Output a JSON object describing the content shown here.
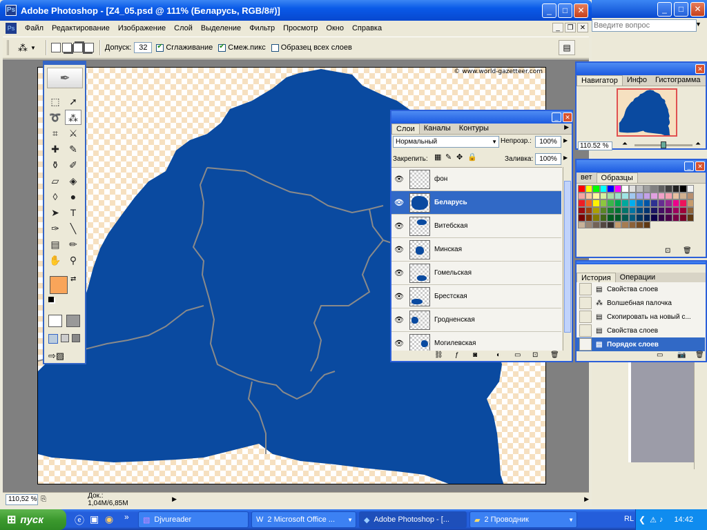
{
  "window": {
    "title": "Adobe Photoshop - [Z4_05.psd @ 111% (Беларусь, RGB/8#)]",
    "min_glyph": "_",
    "max_glyph": "□",
    "close_glyph": "✕"
  },
  "menu": [
    "Файл",
    "Редактирование",
    "Изображение",
    "Слой",
    "Выделение",
    "Фильтр",
    "Просмотр",
    "Окно",
    "Справка"
  ],
  "options": {
    "tolerance_label": "Допуск:",
    "tolerance_value": "32",
    "antialias_label": "Сглаживание",
    "contiguous_label": "Смеж.пикс",
    "sample_all_label": "Образец всех слоев"
  },
  "help": {
    "placeholder": "Введите вопрос"
  },
  "canvas": {
    "copyright": "© www.world-gazetteer.com",
    "map_color": "#0a4aa0",
    "border_color": "#8a8a8a",
    "transparency_color": "#f6e0c0"
  },
  "status": {
    "zoom": "110,52 %",
    "doc": "Док.: 1,04M/6,85M"
  },
  "colors": {
    "foreground": "#f9a55a",
    "background": "#d6ad94"
  },
  "navigator": {
    "tabs": [
      "Навигатор",
      "Инфо",
      "Гистограмма"
    ],
    "zoom": "110.52 %"
  },
  "swatches": {
    "tabs": [
      "вет",
      "Образцы"
    ]
  },
  "layers": {
    "tabs": [
      "Слои",
      "Каналы",
      "Контуры"
    ],
    "blend_mode": "Нормальный",
    "opacity_label": "Непрозр.:",
    "opacity_value": "100%",
    "lock_label": "Закрепить:",
    "fill_label": "Заливка:",
    "fill_value": "100%",
    "items": [
      {
        "name": "фон"
      },
      {
        "name": "Беларусь"
      },
      {
        "name": "Витебская"
      },
      {
        "name": "Минская"
      },
      {
        "name": "Гомельская"
      },
      {
        "name": "Брестская"
      },
      {
        "name": "Гродненская"
      },
      {
        "name": "Могилевская"
      }
    ]
  },
  "history": {
    "tabs": [
      "История",
      "Операции"
    ],
    "items": [
      {
        "label": "Свойства слоев"
      },
      {
        "label": "Волшебная палочка"
      },
      {
        "label": "Скопировать на новый с..."
      },
      {
        "label": "Свойства слоев"
      },
      {
        "label": "Порядок слоев"
      }
    ]
  },
  "taskbar": {
    "start": "пуск",
    "tasks": [
      "Djvureader",
      "2 Microsoft Office ...",
      "Adobe Photoshop - [...",
      "2 Проводник"
    ],
    "lang": "RL",
    "time": "14:42"
  }
}
